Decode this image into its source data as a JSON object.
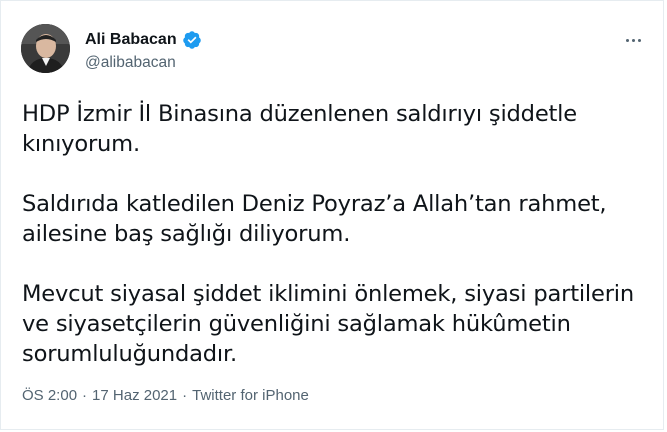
{
  "tweet": {
    "author": {
      "display_name": "Ali Babacan",
      "handle": "@alibabacan",
      "verified": true
    },
    "paragraphs": [
      "HDP İzmir İl Binasına düzenlenen saldırıyı şiddetle\nkınıyorum.",
      "Saldırıda katledilen Deniz Poyraz’a Allah’tan rahmet,\nailesine baş sağlığı diliyorum.",
      "Mevcut siyasal şiddet iklimini önlemek, siyasi partilerin\nve siyasetçilerin güvenliğini sağlamak hükûmetin\nsorumluluğundadır."
    ],
    "time": "ÖS 2:00",
    "separator": "·",
    "date": "17 Haz 2021",
    "source": "Twitter for iPhone"
  },
  "icons": {
    "verified": "verified-badge-icon",
    "more": "more-horizontal-icon"
  },
  "colors": {
    "accent": "#1d9bf0",
    "text": "#0f1419",
    "secondary": "#536471",
    "border": "#e6ecf0"
  }
}
